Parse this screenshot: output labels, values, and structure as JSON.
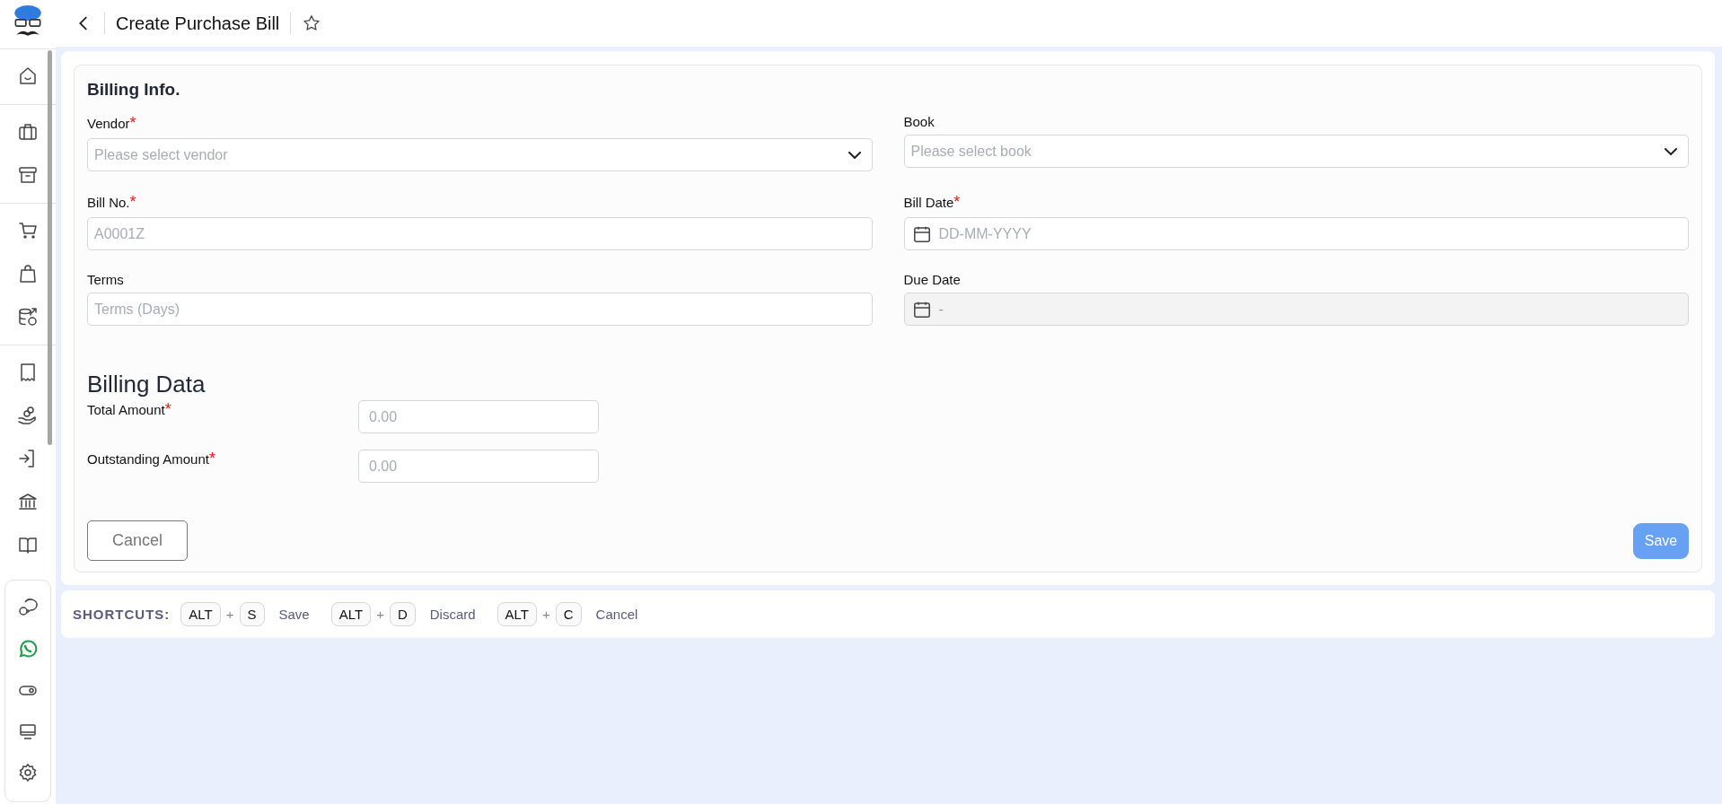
{
  "header": {
    "title": "Create Purchase Bill",
    "favorite": false
  },
  "required_marker": "*",
  "billing_info": {
    "title": "Billing Info.",
    "fields": [
      {
        "label": "Vendor",
        "required": true,
        "kind": "select",
        "placeholder": "Please select vendor",
        "disabled": false
      },
      {
        "label": "Book",
        "required": false,
        "kind": "select",
        "placeholder": "Please select book",
        "disabled": false
      },
      {
        "label": "Bill No.",
        "required": true,
        "kind": "text",
        "placeholder": "A0001Z",
        "disabled": false
      },
      {
        "label": "Bill Date",
        "required": true,
        "kind": "date",
        "placeholder": "DD-MM-YYYY",
        "disabled": false
      },
      {
        "label": "Terms",
        "required": false,
        "kind": "text",
        "placeholder": "Terms (Days)",
        "disabled": false
      },
      {
        "label": "Due Date",
        "required": false,
        "kind": "date",
        "value": "-",
        "disabled": true
      }
    ]
  },
  "billing_data": {
    "title": "Billing Data",
    "fields": [
      {
        "label": "Total Amount",
        "required": true,
        "placeholder": "0.00"
      },
      {
        "label": "Outstanding Amount",
        "required": true,
        "placeholder": "0.00"
      }
    ]
  },
  "buttons": {
    "cancel": "Cancel",
    "save": "Save"
  },
  "shortcuts": {
    "title": "SHORTCUTS:",
    "plus": "+",
    "items": [
      {
        "modifier": "ALT",
        "key": "S",
        "action": "Save"
      },
      {
        "modifier": "ALT",
        "key": "D",
        "action": "Discard"
      },
      {
        "modifier": "ALT",
        "key": "C",
        "action": "Cancel"
      }
    ]
  }
}
